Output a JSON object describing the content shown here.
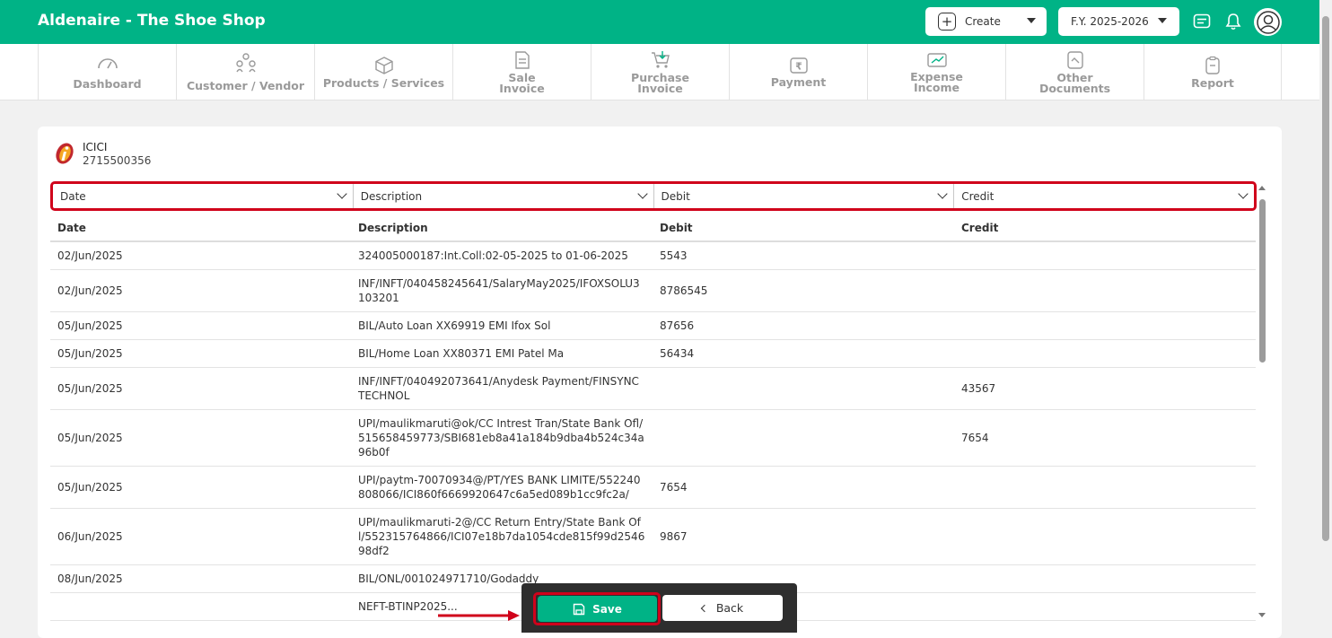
{
  "header": {
    "app_title": "Aldenaire - The Shoe Shop",
    "create_label": "Create",
    "fy_label": "F.Y. 2025-2026",
    "icons": [
      "message-icon",
      "bell-icon",
      "user-avatar-icon"
    ]
  },
  "nav": {
    "items": [
      {
        "label": "Dashboard",
        "icon": "speedometer-icon"
      },
      {
        "label": "Customer / Vendor",
        "icon": "people-icon"
      },
      {
        "label": "Products / Services",
        "icon": "box-icon"
      },
      {
        "label": "Sale Invoice",
        "line1": "Sale",
        "line2": "Invoice",
        "icon": "invoice-icon"
      },
      {
        "label": "Purchase Invoice",
        "line1": "Purchase",
        "line2": "Invoice",
        "icon": "cart-icon"
      },
      {
        "label": "Payment",
        "icon": "rupee-icon"
      },
      {
        "label": "Expense Income",
        "line1": "Expense",
        "line2": "Income",
        "icon": "expense-icon"
      },
      {
        "label": "Other Documents",
        "line1": "Other",
        "line2": "Documents",
        "icon": "document-icon"
      },
      {
        "label": "Report",
        "icon": "clipboard-icon"
      }
    ]
  },
  "bank": {
    "name": "ICICI",
    "account": "2715500356"
  },
  "mapping": {
    "selects": [
      "Date",
      "Description",
      "Debit",
      "Credit"
    ]
  },
  "table": {
    "headers": [
      "Date",
      "Description",
      "Debit",
      "Credit"
    ],
    "rows": [
      {
        "date": "02/Jun/2025",
        "description": "324005000187:Int.Coll:02-05-2025 to 01-06-2025",
        "debit": "5543",
        "credit": ""
      },
      {
        "date": "02/Jun/2025",
        "description": "INF/INFT/040458245641/SalaryMay2025/IFOXSOLU3103201",
        "debit": "8786545",
        "credit": ""
      },
      {
        "date": "05/Jun/2025",
        "description": "BIL/Auto Loan XX69919 EMI Ifox Sol",
        "debit": "87656",
        "credit": ""
      },
      {
        "date": "05/Jun/2025",
        "description": "BIL/Home Loan XX80371 EMI Patel Ma",
        "debit": "56434",
        "credit": ""
      },
      {
        "date": "05/Jun/2025",
        "description": "INF/INFT/040492073641/Anydesk Payment/FINSYNC TECHNOL",
        "debit": "",
        "credit": "43567"
      },
      {
        "date": "05/Jun/2025",
        "description": "UPI/maulikmaruti@ok/CC Intrest Tran/State Bank Ofl/515658459773/SBI681eb8a41a184b9dba4b524c34a96b0f",
        "debit": "",
        "credit": "7654"
      },
      {
        "date": "05/Jun/2025",
        "description": "UPI/paytm-70070934@/PT/YES BANK LIMITE/552240808066/ICI860f6669920647c6a5ed089b1cc9fc2a/",
        "debit": "7654",
        "credit": ""
      },
      {
        "date": "06/Jun/2025",
        "description": "UPI/maulikmaruti-2@/CC Return Entry/State Bank Ofl/552315764866/ICI07e18b7da1054cde815f99d254698df2",
        "debit": "9867",
        "credit": ""
      },
      {
        "date": "08/Jun/2025",
        "description": "BIL/ONL/001024971710/Godaddy",
        "debit": "",
        "credit": ""
      },
      {
        "date": "",
        "description": "NEFT-BTINP2025...",
        "debit": "",
        "credit": ""
      }
    ]
  },
  "actions": {
    "save_label": "Save",
    "back_label": "Back"
  },
  "colors": {
    "brand": "#00b386",
    "highlight": "#d0021b"
  }
}
